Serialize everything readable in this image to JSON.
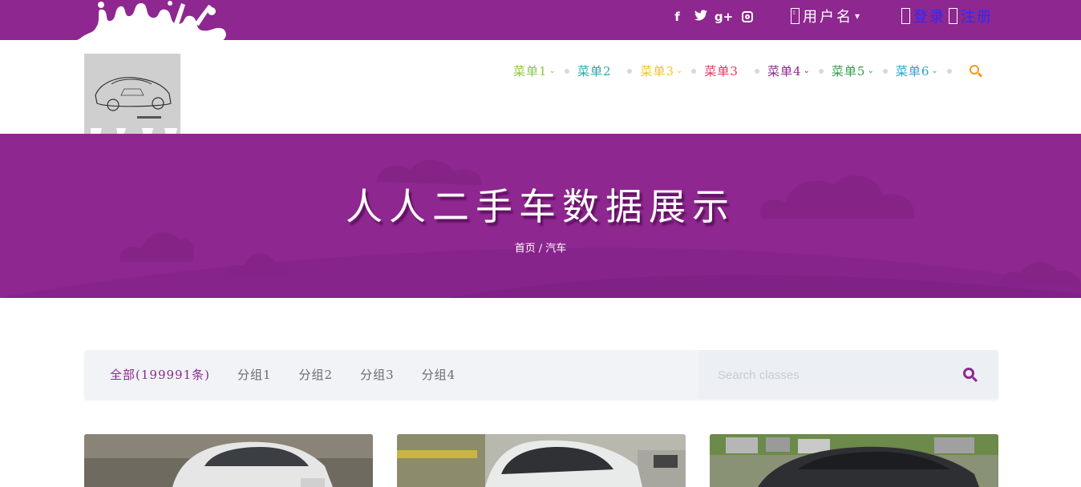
{
  "topbar": {
    "social": [
      {
        "icon": "facebook-icon",
        "glyph": "f"
      },
      {
        "icon": "twitter-icon",
        "glyph": "𝕥"
      },
      {
        "icon": "google-plus-icon",
        "glyph": "g+"
      },
      {
        "icon": "instagram-icon",
        "glyph": ""
      }
    ],
    "username": "用户名",
    "login": "登录",
    "register": "注册"
  },
  "nav": {
    "items": [
      {
        "label": "菜单1",
        "color": "#8cc63f",
        "dropdown": true
      },
      {
        "label": "菜单2",
        "color": "#2aa7a7",
        "dropdown": false
      },
      {
        "label": "菜单3",
        "color": "#f2c12e",
        "dropdown": true
      },
      {
        "label": "菜单3",
        "color": "#e4335e",
        "dropdown": false
      },
      {
        "label": "菜单4",
        "color": "#8e278f",
        "dropdown": true
      },
      {
        "label": "菜单5",
        "color": "#2e9e4a",
        "dropdown": true
      },
      {
        "label": "菜单6",
        "color": "#2a9fd6",
        "dropdown": true
      }
    ],
    "search_color": "#f39a1b"
  },
  "banner": {
    "title": "人人二手车数据展示",
    "breadcrumb_home": "首页",
    "breadcrumb_sep": "/",
    "breadcrumb_current": "汽车"
  },
  "filter": {
    "tabs": [
      "全部(199991条)",
      "分组1",
      "分组2",
      "分组3",
      "分组4"
    ],
    "active_index": 0,
    "search_placeholder": "Search classes"
  },
  "colors": {
    "brand": "#8e278f",
    "banner": "#8e278f"
  }
}
